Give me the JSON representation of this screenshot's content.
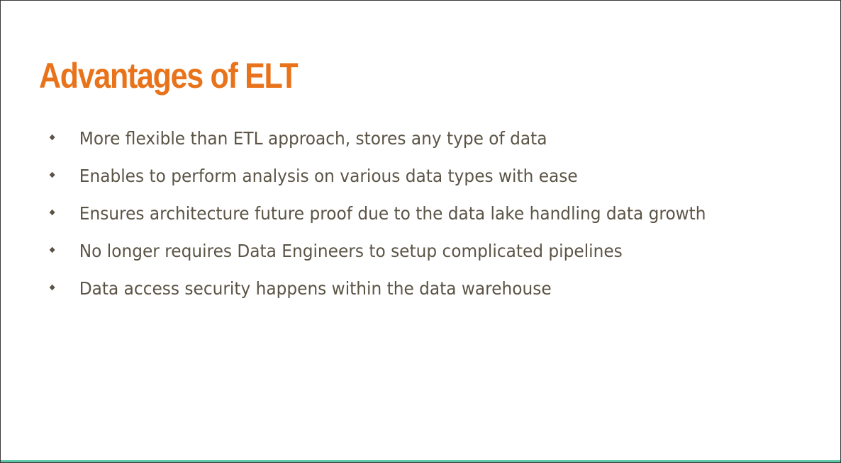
{
  "slide": {
    "title": "Advantages of ELT",
    "bullets": [
      "More flexible than ETL approach, stores any type of data",
      "Enables to perform analysis on various data types with ease",
      "Ensures architecture future proof due to the data lake handling data growth",
      "No longer requires Data Engineers to setup complicated pipelines",
      "Data access security happens within the data warehouse"
    ]
  },
  "colors": {
    "title": "#e8731a",
    "body_text": "#5b5446",
    "accent_line": "#5cc6a6"
  }
}
